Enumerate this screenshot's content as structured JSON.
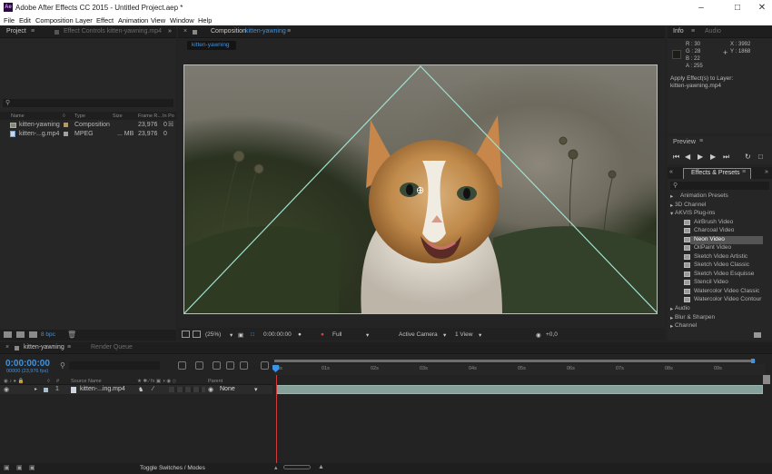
{
  "window": {
    "title": "Adobe After Effects CC 2015 - Untitled Project.aep *",
    "logo": "Ae"
  },
  "menu": [
    "File",
    "Edit",
    "Composition",
    "Layer",
    "Effect",
    "Animation",
    "View",
    "Window",
    "Help"
  ],
  "project_panel": {
    "tabs": {
      "project": "Project",
      "effect_controls": "Effect Controls kitten-yawning.mp4"
    },
    "columns": {
      "name": "Name",
      "type": "Type",
      "size": "Size",
      "frame_rate": "Frame R...",
      "in_point": "In Po"
    },
    "items": [
      {
        "name": "kitten-yawning",
        "type": "Composition",
        "size": "",
        "frame_rate": "23,976",
        "in": "0"
      },
      {
        "name": "kitten-...g.mp4",
        "type": "MPEG",
        "size": "... MB",
        "frame_rate": "23,976",
        "in": "0"
      }
    ],
    "bpc": "8 bpc"
  },
  "composition_panel": {
    "tab_prefix": "Composition",
    "tab_name": "kitten-yawning",
    "subtab": "kitten-yawning",
    "controls": {
      "zoom": "(25%)",
      "timecode": "0:00:00:00",
      "resolution": "Full",
      "camera": "Active Camera",
      "views": "1 View",
      "exposure": "+0,0"
    }
  },
  "info_panel": {
    "tabs": {
      "info": "Info",
      "audio": "Audio"
    },
    "r": "R : 30",
    "g": "G : 28",
    "b": "B : 22",
    "a": "A : 255",
    "x": "X : 3992",
    "y": "Y : 1868",
    "message": "Apply Effect(s) to Layer:",
    "layer": "kitten-yawning.mp4"
  },
  "preview_panel": {
    "title": "Preview"
  },
  "effects_panel": {
    "title": "Effects & Presets",
    "categories": [
      "Animation Presets",
      "3D Channel",
      "AKVIS Plug-ins"
    ],
    "plugins": [
      "AirBrush Video",
      "Charcoal Video",
      "Neon Video",
      "OilPaint Video",
      "Sketch Video Artistic",
      "Sketch Video Classic",
      "Sketch Video Esquisse",
      "Stencil Video",
      "Watercolor Video Classic",
      "Watercolor Video Contour"
    ],
    "more_categories": [
      "Audio",
      "Blur & Sharpen",
      "Channel"
    ],
    "selected": "Neon Video"
  },
  "timeline": {
    "tabs": {
      "comp": "kitten-yawning",
      "render": "Render Queue"
    },
    "timecode": "0:00:00:00",
    "fps": "00000 (23,976 fps)",
    "columns": {
      "source": "Source Name",
      "parent": "Parent"
    },
    "layer": {
      "index": "1",
      "name": "kitten-...ing.mp4",
      "parent": "None"
    },
    "ruler": [
      "0s",
      "01s",
      "02s",
      "03s",
      "04s",
      "05s",
      "06s",
      "07s",
      "08s",
      "09s"
    ],
    "toggle_label": "Toggle Switches / Modes"
  },
  "colors": {
    "accent": "#3f93e0",
    "mask": "#9fe0d0"
  }
}
